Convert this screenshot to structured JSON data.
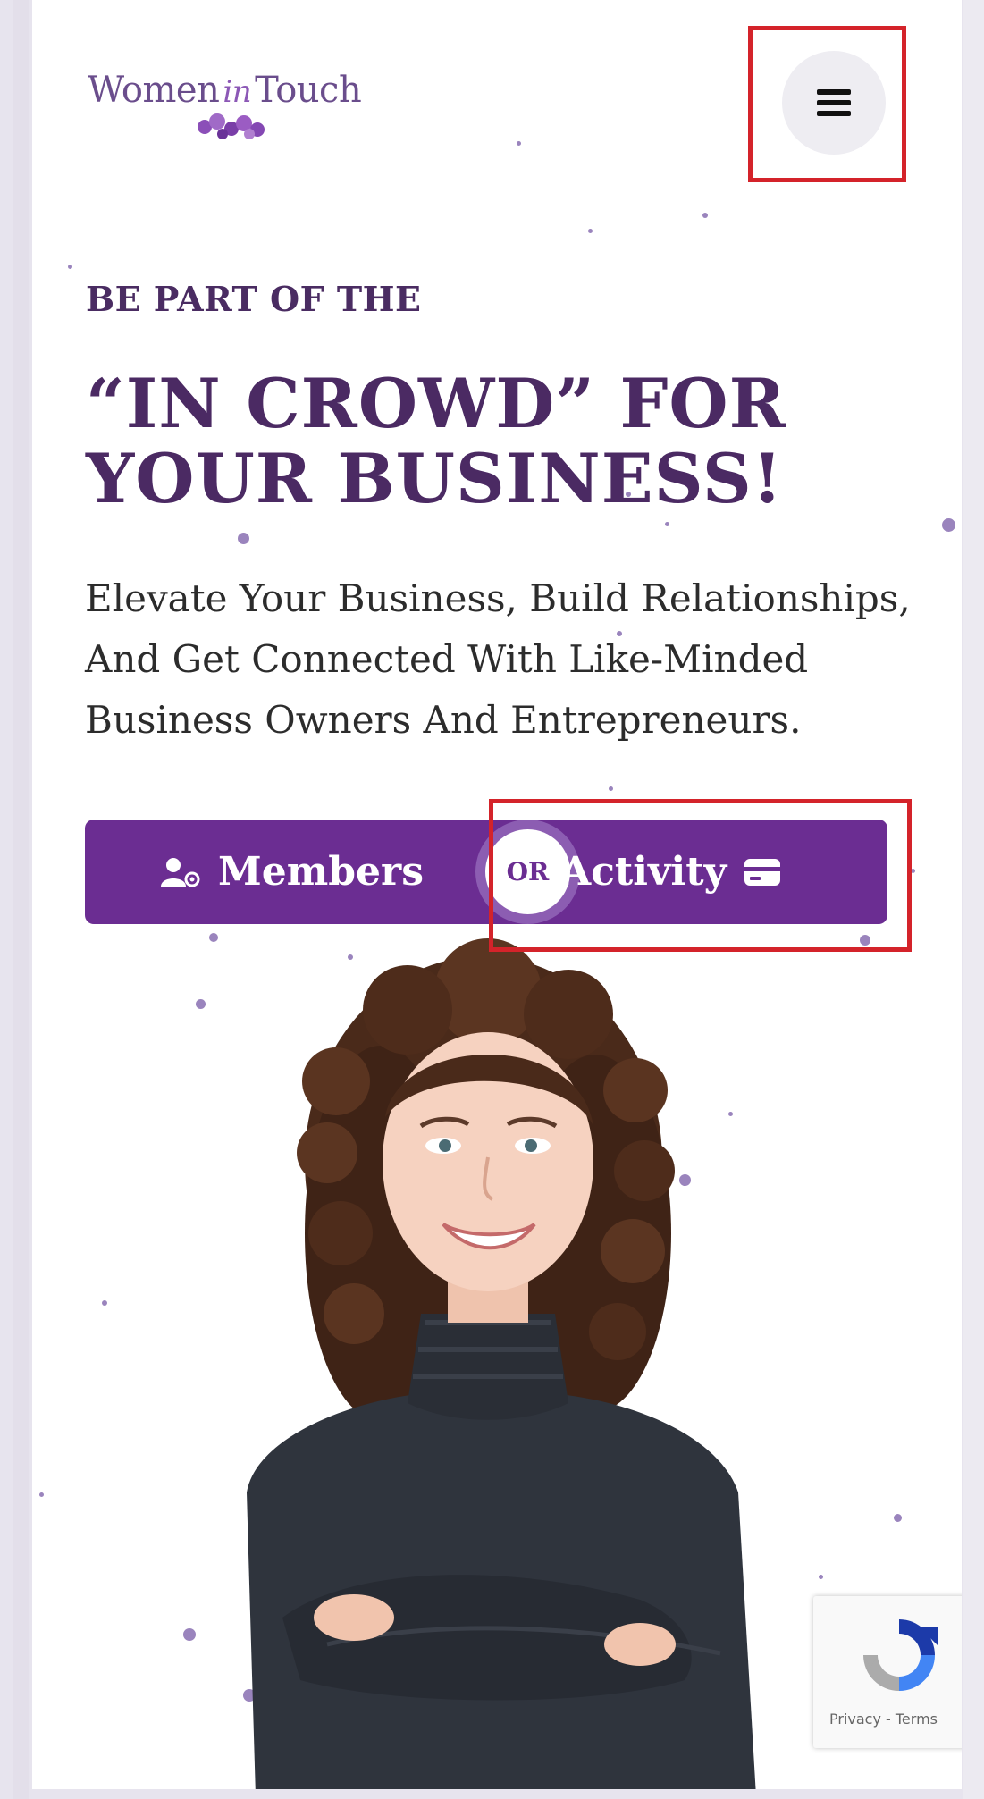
{
  "brand": {
    "logo_text_left": "Women",
    "logo_text_mid": "in",
    "logo_text_right": "Touch",
    "accent_color": "#6b2d92",
    "heading_color": "#4b2a63"
  },
  "header": {
    "menu_icon": "hamburger-menu-icon"
  },
  "hero": {
    "eyebrow": "BE PART OF THE",
    "headline": "“IN CROWD” FOR YOUR BUSINESS!",
    "subtext": "Elevate Your Business, Build Relationships, And Get Connected With Like-Minded Business Owners And Entrepreneurs."
  },
  "cta": {
    "members_label": "Members",
    "members_icon": "user-gear-icon",
    "or_label": "OR",
    "activity_label": "Activity",
    "activity_icon": "card-icon"
  },
  "recaptcha": {
    "links": "Privacy - Terms"
  }
}
